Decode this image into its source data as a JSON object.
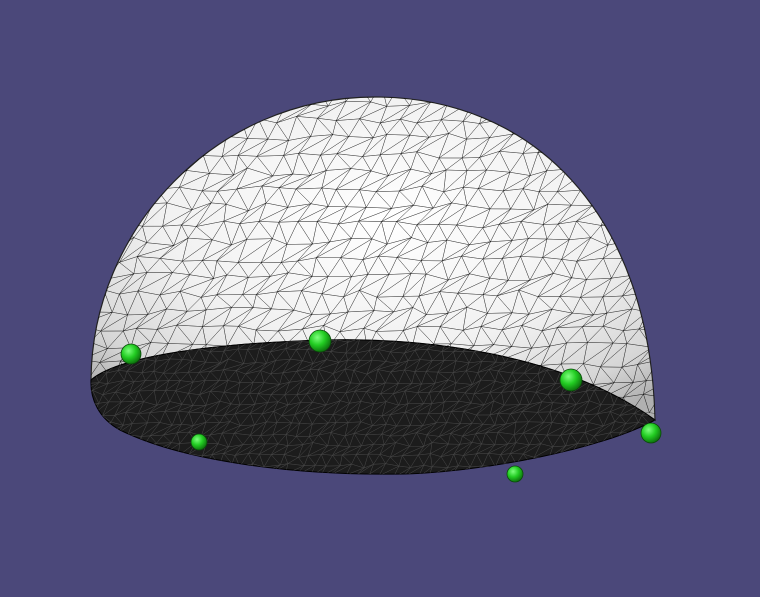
{
  "viewport": {
    "background_color": "#4b487a",
    "object": "hemisphere-triangle-mesh",
    "dome_color": "#f2f2f2",
    "base_color": "#1c1c1c",
    "edge_color": "#000000",
    "marker_color": "#22dd22",
    "marker_count": 6
  }
}
